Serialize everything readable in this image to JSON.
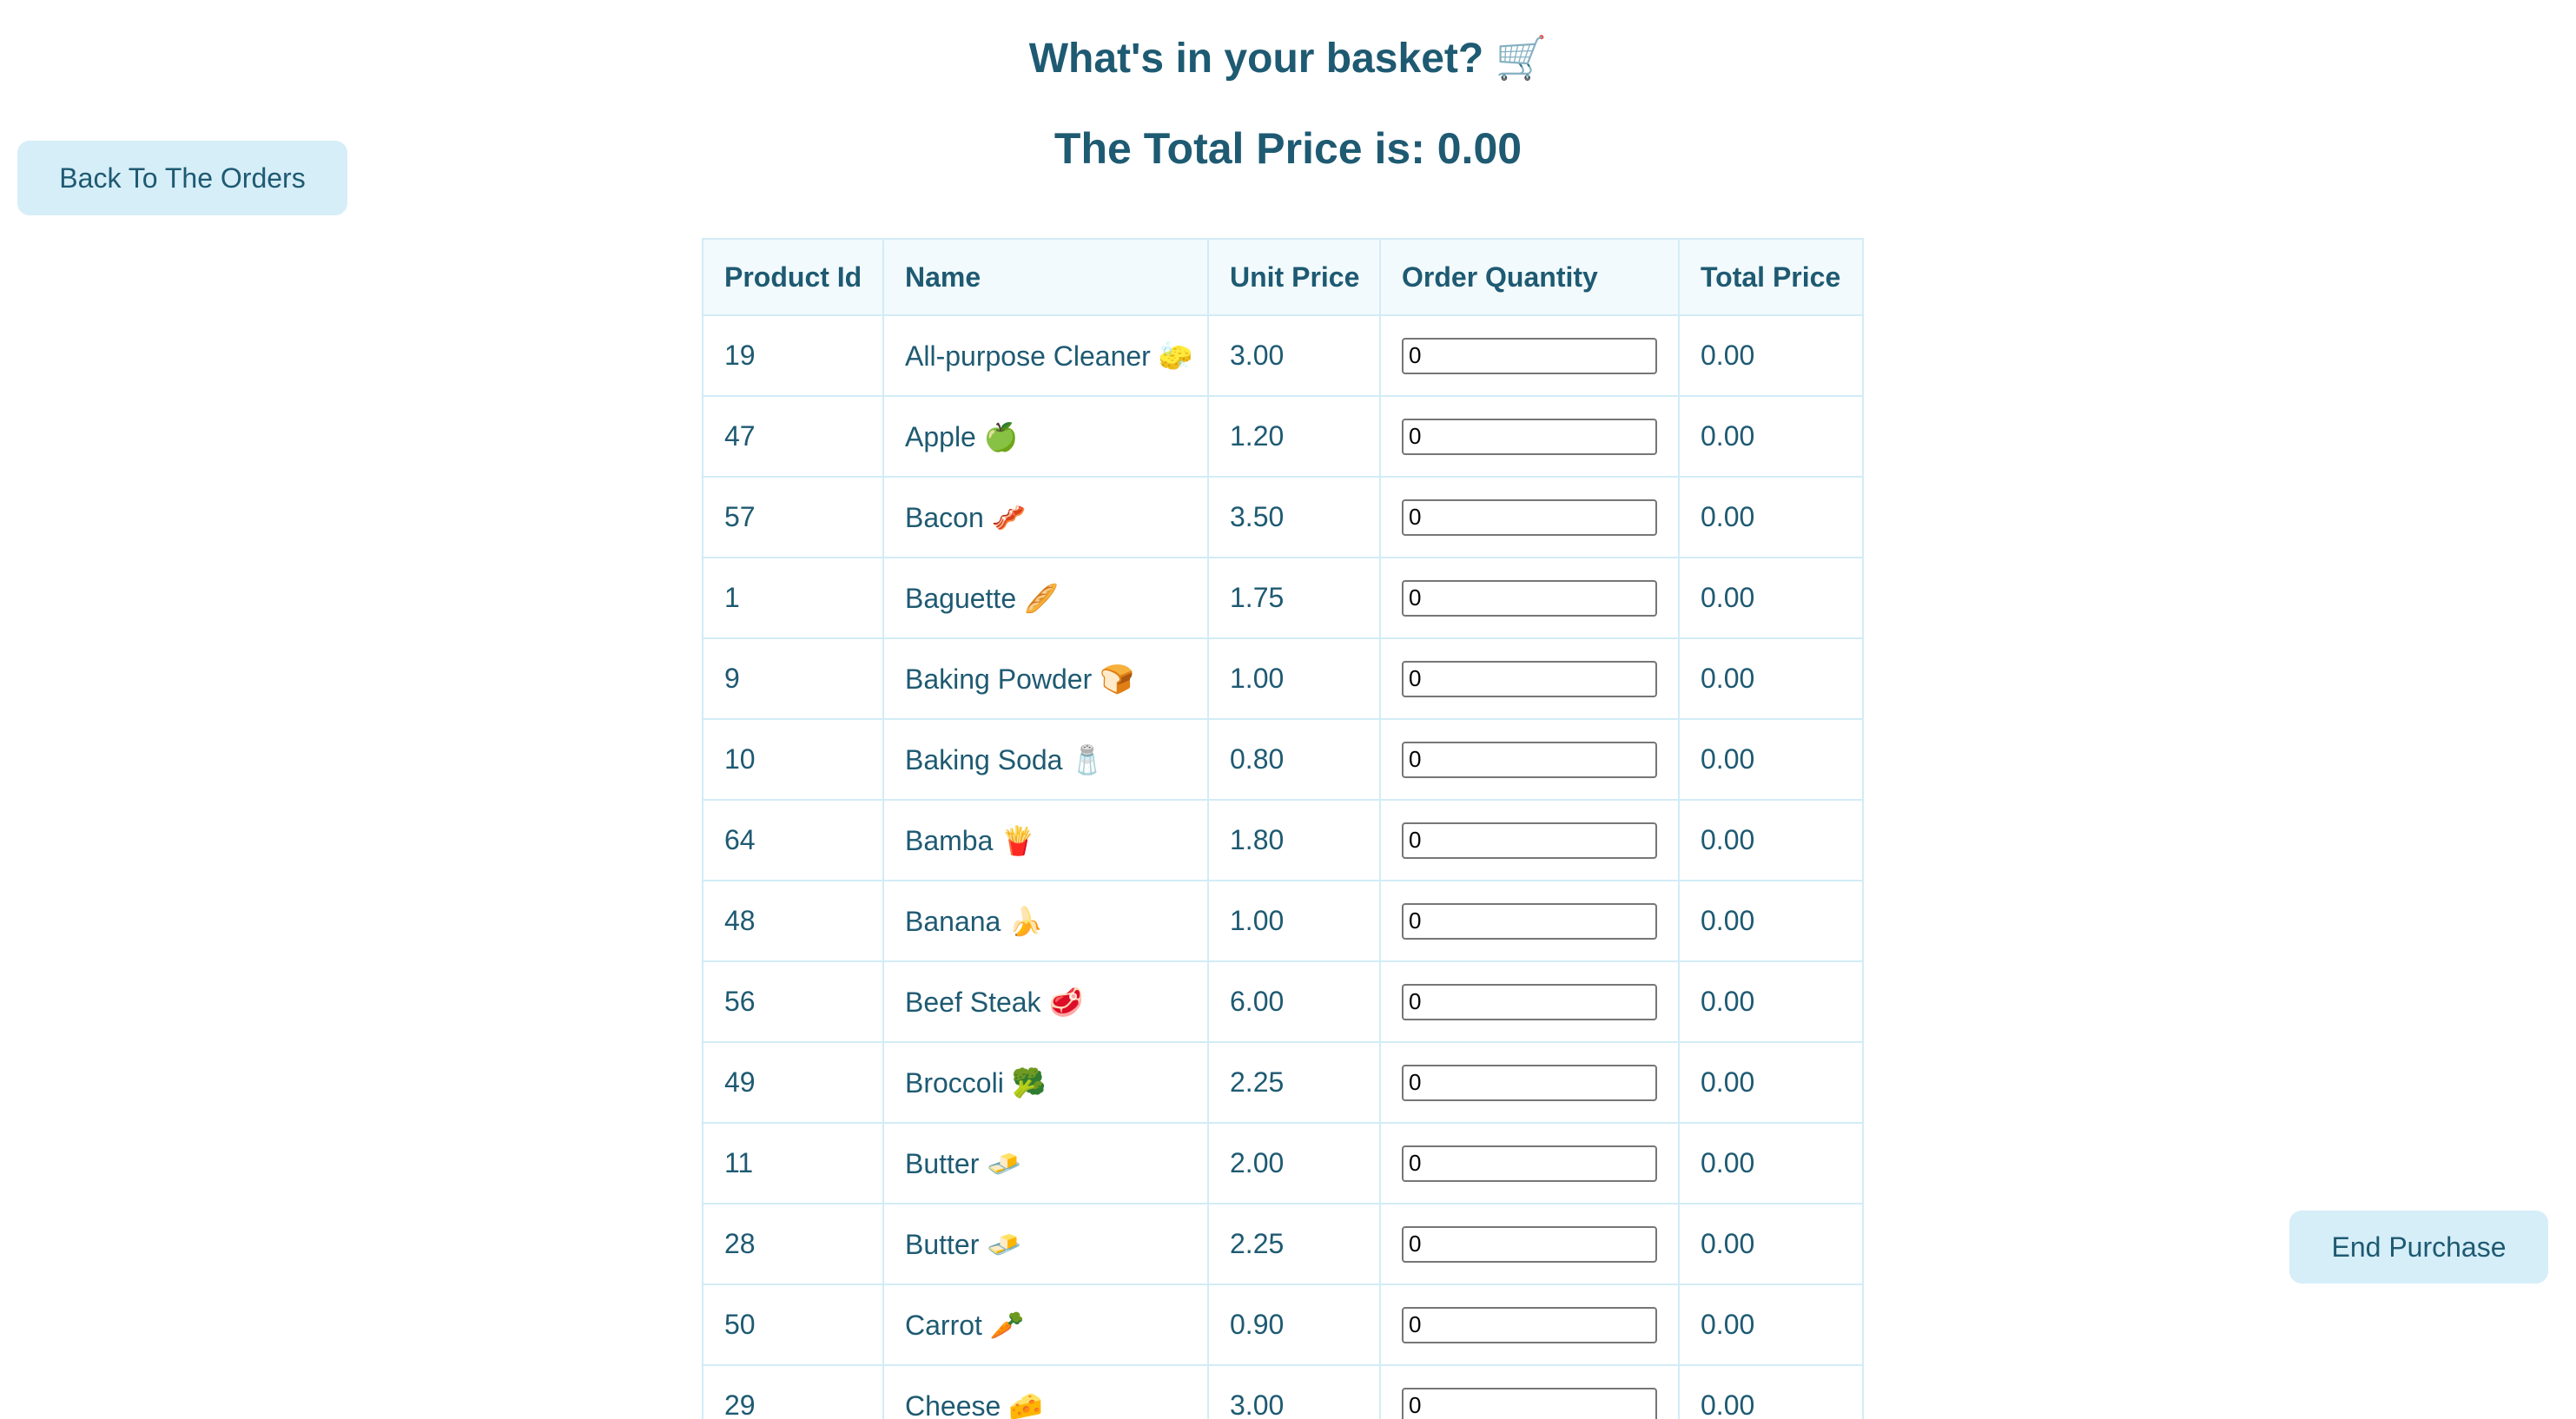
{
  "header": {
    "title": "What's in your basket? 🛒",
    "total_label": "The Total Price is: 0.00"
  },
  "actions": {
    "back_label": "Back To The Orders",
    "end_label": "End Purchase"
  },
  "table": {
    "columns": [
      "Product Id",
      "Name",
      "Unit Price",
      "Order Quantity",
      "Total Price"
    ],
    "rows": [
      {
        "id": "19",
        "name": "All-purpose Cleaner 🧽",
        "unit": "3.00",
        "qty": "0",
        "total": "0.00"
      },
      {
        "id": "47",
        "name": "Apple 🍏",
        "unit": "1.20",
        "qty": "0",
        "total": "0.00"
      },
      {
        "id": "57",
        "name": "Bacon 🥓",
        "unit": "3.50",
        "qty": "0",
        "total": "0.00"
      },
      {
        "id": "1",
        "name": "Baguette 🥖",
        "unit": "1.75",
        "qty": "0",
        "total": "0.00"
      },
      {
        "id": "9",
        "name": "Baking Powder 🍞",
        "unit": "1.00",
        "qty": "0",
        "total": "0.00"
      },
      {
        "id": "10",
        "name": "Baking Soda 🧂",
        "unit": "0.80",
        "qty": "0",
        "total": "0.00"
      },
      {
        "id": "64",
        "name": "Bamba 🍟",
        "unit": "1.80",
        "qty": "0",
        "total": "0.00"
      },
      {
        "id": "48",
        "name": "Banana 🍌",
        "unit": "1.00",
        "qty": "0",
        "total": "0.00"
      },
      {
        "id": "56",
        "name": "Beef Steak 🥩",
        "unit": "6.00",
        "qty": "0",
        "total": "0.00"
      },
      {
        "id": "49",
        "name": "Broccoli 🥦",
        "unit": "2.25",
        "qty": "0",
        "total": "0.00"
      },
      {
        "id": "11",
        "name": "Butter 🧈",
        "unit": "2.00",
        "qty": "0",
        "total": "0.00"
      },
      {
        "id": "28",
        "name": "Butter 🧈",
        "unit": "2.25",
        "qty": "0",
        "total": "0.00"
      },
      {
        "id": "50",
        "name": "Carrot 🥕",
        "unit": "0.90",
        "qty": "0",
        "total": "0.00"
      },
      {
        "id": "29",
        "name": "Cheese 🧀",
        "unit": "3.00",
        "qty": "0",
        "total": "0.00"
      }
    ]
  }
}
